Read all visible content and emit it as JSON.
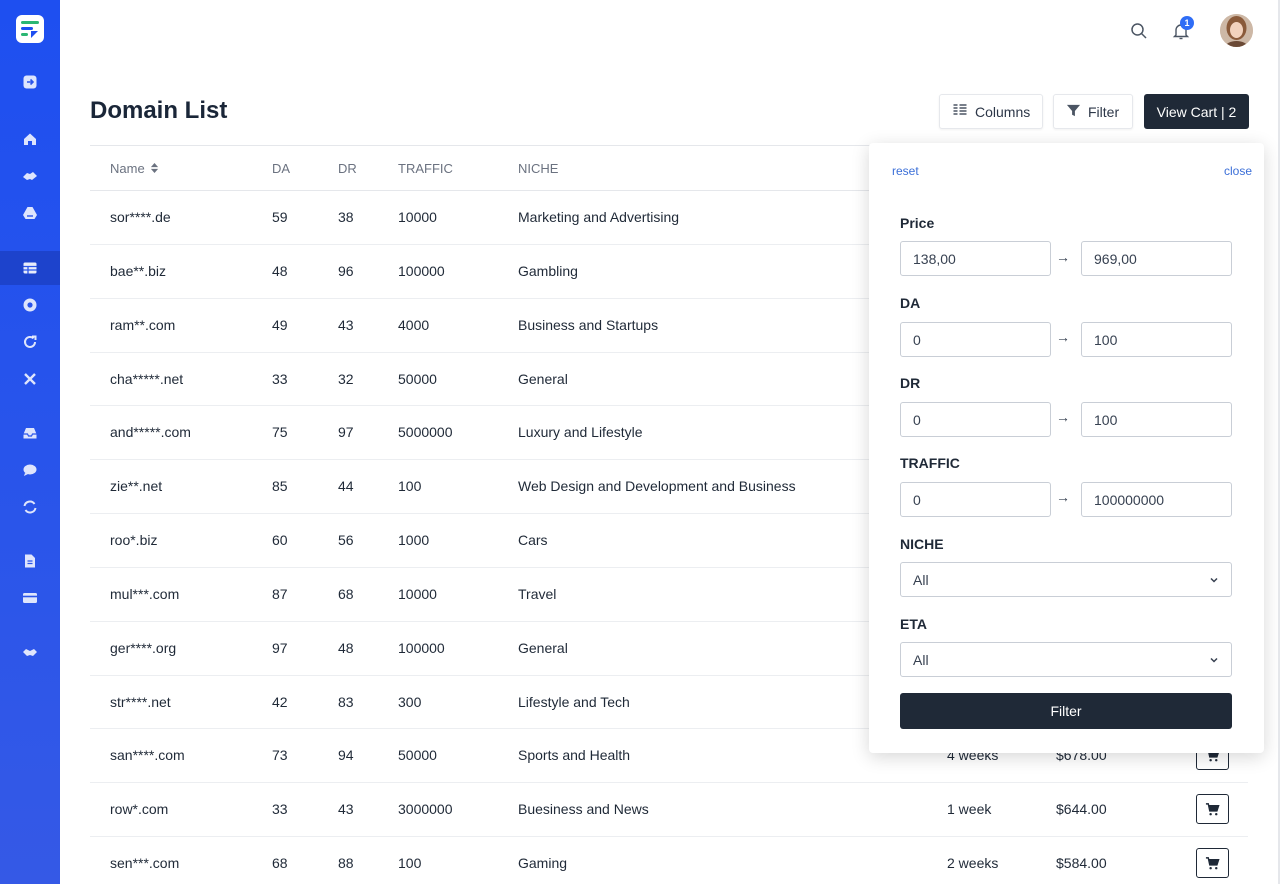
{
  "header": {
    "page_title": "Domain List",
    "notification_count": "1",
    "columns_label": "Columns",
    "filter_label": "Filter",
    "cart_label": "View Cart | 2"
  },
  "sidebar": {
    "accent": "#1e4ff0",
    "icons": [
      "logout-icon",
      "home-icon",
      "handshake-icon",
      "drive-icon",
      "table-icon",
      "record-icon",
      "refresh-icon",
      "tools-icon",
      "inbox-icon",
      "chat-icon",
      "sync-icon",
      "document-icon",
      "credit-card-icon",
      "partnership-icon"
    ]
  },
  "table": {
    "headers": {
      "name": "Name",
      "da": "DA",
      "dr": "DR",
      "traffic": "TRAFFIC",
      "niche": "NICHE"
    },
    "rows": [
      {
        "name": "sor****.de",
        "da": "59",
        "dr": "38",
        "traffic": "10000",
        "niche": "Marketing and Advertising",
        "eta": "",
        "price": ""
      },
      {
        "name": "bae**.biz",
        "da": "48",
        "dr": "96",
        "traffic": "100000",
        "niche": "Gambling",
        "eta": "",
        "price": ""
      },
      {
        "name": "ram**.com",
        "da": "49",
        "dr": "43",
        "traffic": "4000",
        "niche": "Business and Startups",
        "eta": "",
        "price": ""
      },
      {
        "name": "cha*****.net",
        "da": "33",
        "dr": "32",
        "traffic": "50000",
        "niche": "General",
        "eta": "",
        "price": ""
      },
      {
        "name": "and*****.com",
        "da": "75",
        "dr": "97",
        "traffic": "5000000",
        "niche": "Luxury and Lifestyle",
        "eta": "",
        "price": ""
      },
      {
        "name": "zie**.net",
        "da": "85",
        "dr": "44",
        "traffic": "100",
        "niche": "Web Design and Development and Business",
        "eta": "",
        "price": ""
      },
      {
        "name": "roo*.biz",
        "da": "60",
        "dr": "56",
        "traffic": "1000",
        "niche": "Cars",
        "eta": "",
        "price": ""
      },
      {
        "name": "mul***.com",
        "da": "87",
        "dr": "68",
        "traffic": "10000",
        "niche": "Travel",
        "eta": "",
        "price": ""
      },
      {
        "name": "ger****.org",
        "da": "97",
        "dr": "48",
        "traffic": "100000",
        "niche": "General",
        "eta": "",
        "price": ""
      },
      {
        "name": "str****.net",
        "da": "42",
        "dr": "83",
        "traffic": "300",
        "niche": "Lifestyle and Tech",
        "eta": "",
        "price": ""
      },
      {
        "name": "san****.com",
        "da": "73",
        "dr": "94",
        "traffic": "50000",
        "niche": "Sports and Health",
        "eta": "4 weeks",
        "price": "$678.00"
      },
      {
        "name": "row*.com",
        "da": "33",
        "dr": "43",
        "traffic": "3000000",
        "niche": "Buesiness and News",
        "eta": "1 week",
        "price": "$644.00"
      },
      {
        "name": "sen***.com",
        "da": "68",
        "dr": "88",
        "traffic": "100",
        "niche": "Gaming",
        "eta": "2 weeks",
        "price": "$584.00"
      }
    ]
  },
  "filter_panel": {
    "reset_label": "reset",
    "close_label": "close",
    "price": {
      "label": "Price",
      "min": "138,00",
      "max": "969,00"
    },
    "da": {
      "label": "DA",
      "min": "0",
      "max": "100"
    },
    "dr": {
      "label": "DR",
      "min": "0",
      "max": "100"
    },
    "traffic": {
      "label": "TRAFFIC",
      "min": "0",
      "max": "100000000"
    },
    "niche": {
      "label": "NICHE",
      "value": "All"
    },
    "eta": {
      "label": "ETA",
      "value": "All"
    },
    "submit_label": "Filter",
    "arrow": "→"
  }
}
